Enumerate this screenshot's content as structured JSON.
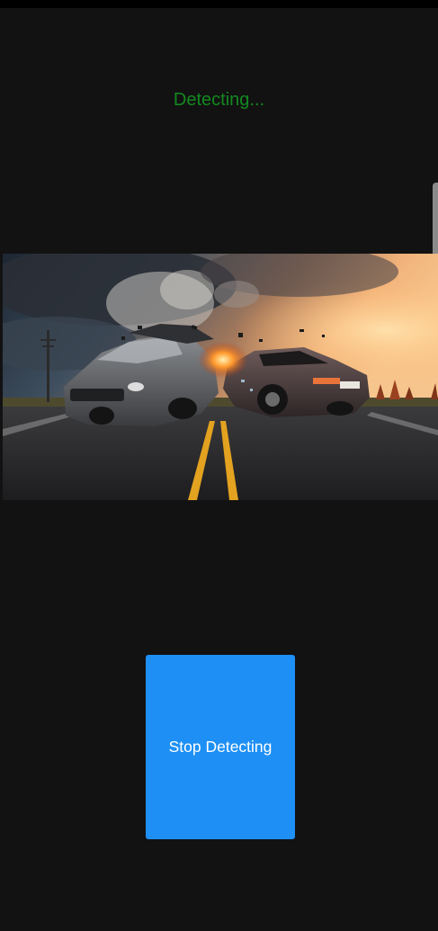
{
  "status": {
    "text": "Detecting...",
    "color": "#12891f"
  },
  "image": {
    "subject": "two-car head-on collision on a highway at sunset"
  },
  "actions": {
    "stop_label": "Stop Detecting",
    "stop_color": "#1e90f5"
  },
  "colors": {
    "background": "#121212"
  }
}
